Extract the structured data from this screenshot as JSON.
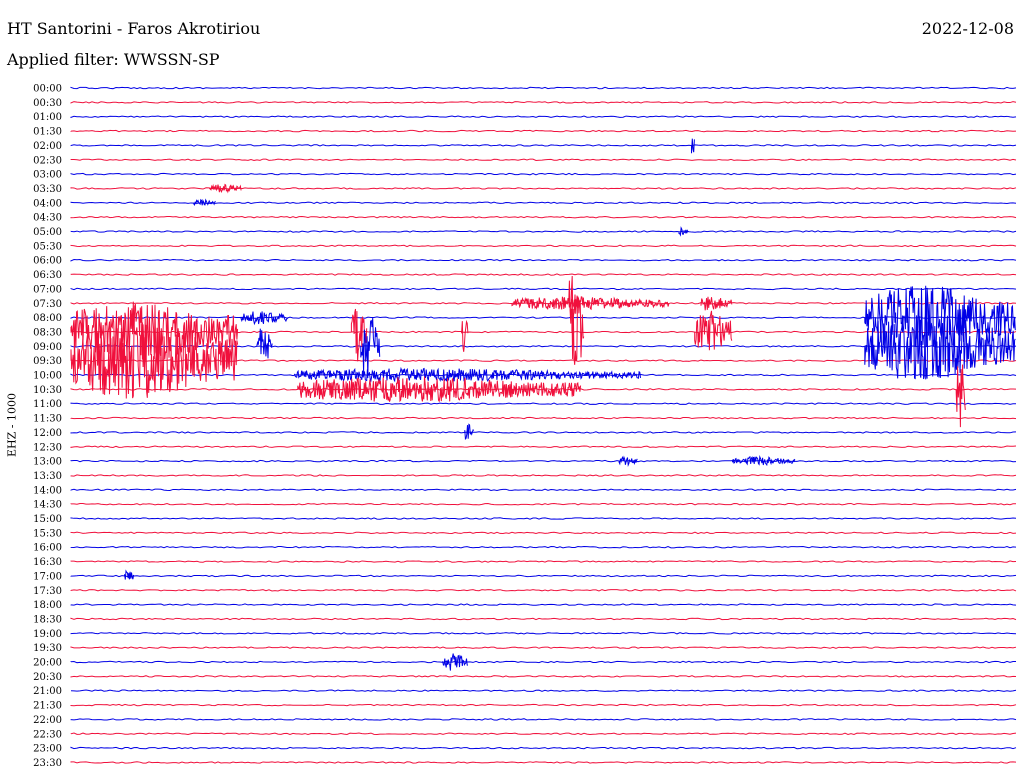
{
  "header": {
    "title": "HT Santorini - Faros Akrotiriou",
    "date": "2022-12-08",
    "filter": "Applied filter: WWSSN-SP"
  },
  "y_axis_label": "EHZ - 1000",
  "colors": {
    "blue": "#0000e6",
    "red": "#f0103c",
    "background": "#ffffff"
  },
  "chart_data": {
    "type": "line",
    "description_kind": "helicorder",
    "row_labels": [
      "00:00",
      "00:30",
      "01:00",
      "01:30",
      "02:00",
      "02:30",
      "03:00",
      "03:30",
      "04:00",
      "04:30",
      "05:00",
      "05:30",
      "06:00",
      "06:30",
      "07:00",
      "07:30",
      "08:00",
      "08:30",
      "09:00",
      "09:30",
      "10:00",
      "10:30",
      "11:00",
      "11:30",
      "12:00",
      "12:30",
      "13:00",
      "13:30",
      "14:00",
      "14:30",
      "15:00",
      "15:30",
      "16:00",
      "16:30",
      "17:00",
      "17:30",
      "18:00",
      "18:30",
      "19:00",
      "19:30",
      "20:00",
      "20:30",
      "21:00",
      "21:30",
      "22:00",
      "22:30",
      "23:00",
      "23:30"
    ],
    "row_colors": [
      "blue",
      "red"
    ],
    "x_minutes": [
      0,
      30
    ],
    "events": [
      {
        "row": "02:00",
        "minute": 19.7,
        "duration": 0.1,
        "amplitude": 6
      },
      {
        "row": "03:30",
        "minute": 4.4,
        "duration": 1.0,
        "amplitude": 2
      },
      {
        "row": "04:00",
        "minute": 3.9,
        "duration": 0.7,
        "amplitude": 1.5
      },
      {
        "row": "05:00",
        "minute": 19.3,
        "duration": 0.3,
        "amplitude": 2
      },
      {
        "row": "07:30",
        "minute": 14.0,
        "duration": 5.0,
        "amplitude": 3
      },
      {
        "row": "07:30",
        "minute": 15.8,
        "duration": 0.3,
        "amplitude": 14
      },
      {
        "row": "07:30",
        "minute": 20.0,
        "duration": 1.0,
        "amplitude": 4
      },
      {
        "row": "08:00",
        "minute": 5.4,
        "duration": 1.5,
        "amplitude": 3
      },
      {
        "row": "08:00",
        "minute": 25.2,
        "duration": 5.0,
        "amplitude": 15
      },
      {
        "row": "08:30",
        "minute": 8.9,
        "duration": 0.5,
        "amplitude": 14
      },
      {
        "row": "08:30",
        "minute": 12.4,
        "duration": 0.2,
        "amplitude": 10
      },
      {
        "row": "08:30",
        "minute": 15.9,
        "duration": 0.4,
        "amplitude": 18
      },
      {
        "row": "08:30",
        "minute": 19.8,
        "duration": 1.2,
        "amplitude": 10
      },
      {
        "row": "08:30",
        "minute": 0.0,
        "duration": 5.3,
        "amplitude": 14
      },
      {
        "row": "09:00",
        "minute": 5.9,
        "duration": 0.5,
        "amplitude": 9
      },
      {
        "row": "09:00",
        "minute": 9.2,
        "duration": 0.6,
        "amplitude": 16
      },
      {
        "row": "09:00",
        "minute": 25.2,
        "duration": 4.8,
        "amplitude": 16
      },
      {
        "row": "09:30",
        "minute": 0.0,
        "duration": 5.3,
        "amplitude": 18
      },
      {
        "row": "10:00",
        "minute": 7.1,
        "duration": 11.0,
        "amplitude": 3
      },
      {
        "row": "10:30",
        "minute": 7.2,
        "duration": 9.0,
        "amplitude": 6
      },
      {
        "row": "10:30",
        "minute": 28.1,
        "duration": 0.3,
        "amplitude": 18
      },
      {
        "row": "12:00",
        "minute": 12.5,
        "duration": 0.3,
        "amplitude": 4
      },
      {
        "row": "13:00",
        "minute": 17.4,
        "duration": 0.6,
        "amplitude": 2
      },
      {
        "row": "13:00",
        "minute": 21.0,
        "duration": 2.0,
        "amplitude": 2
      },
      {
        "row": "17:00",
        "minute": 1.7,
        "duration": 0.3,
        "amplitude": 3
      },
      {
        "row": "20:00",
        "minute": 11.8,
        "duration": 0.8,
        "amplitude": 4
      }
    ]
  }
}
